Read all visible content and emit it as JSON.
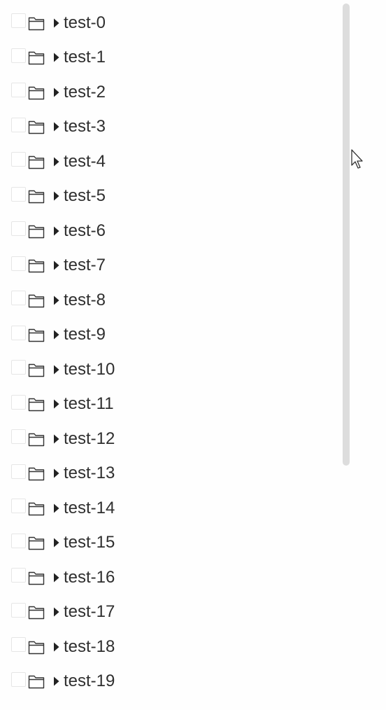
{
  "tree": {
    "items": [
      {
        "label": "test-0"
      },
      {
        "label": "test-1"
      },
      {
        "label": "test-2"
      },
      {
        "label": "test-3"
      },
      {
        "label": "test-4"
      },
      {
        "label": "test-5"
      },
      {
        "label": "test-6"
      },
      {
        "label": "test-7"
      },
      {
        "label": "test-8"
      },
      {
        "label": "test-9"
      },
      {
        "label": "test-10"
      },
      {
        "label": "test-11"
      },
      {
        "label": "test-12"
      },
      {
        "label": "test-13"
      },
      {
        "label": "test-14"
      },
      {
        "label": "test-15"
      },
      {
        "label": "test-16"
      },
      {
        "label": "test-17"
      },
      {
        "label": "test-18"
      },
      {
        "label": "test-19"
      }
    ],
    "row_icon": "folder-icon",
    "expander_icon": "caret-right-icon",
    "text_color": "#2f2f2f",
    "scrollbar_color": "#dddddd"
  }
}
